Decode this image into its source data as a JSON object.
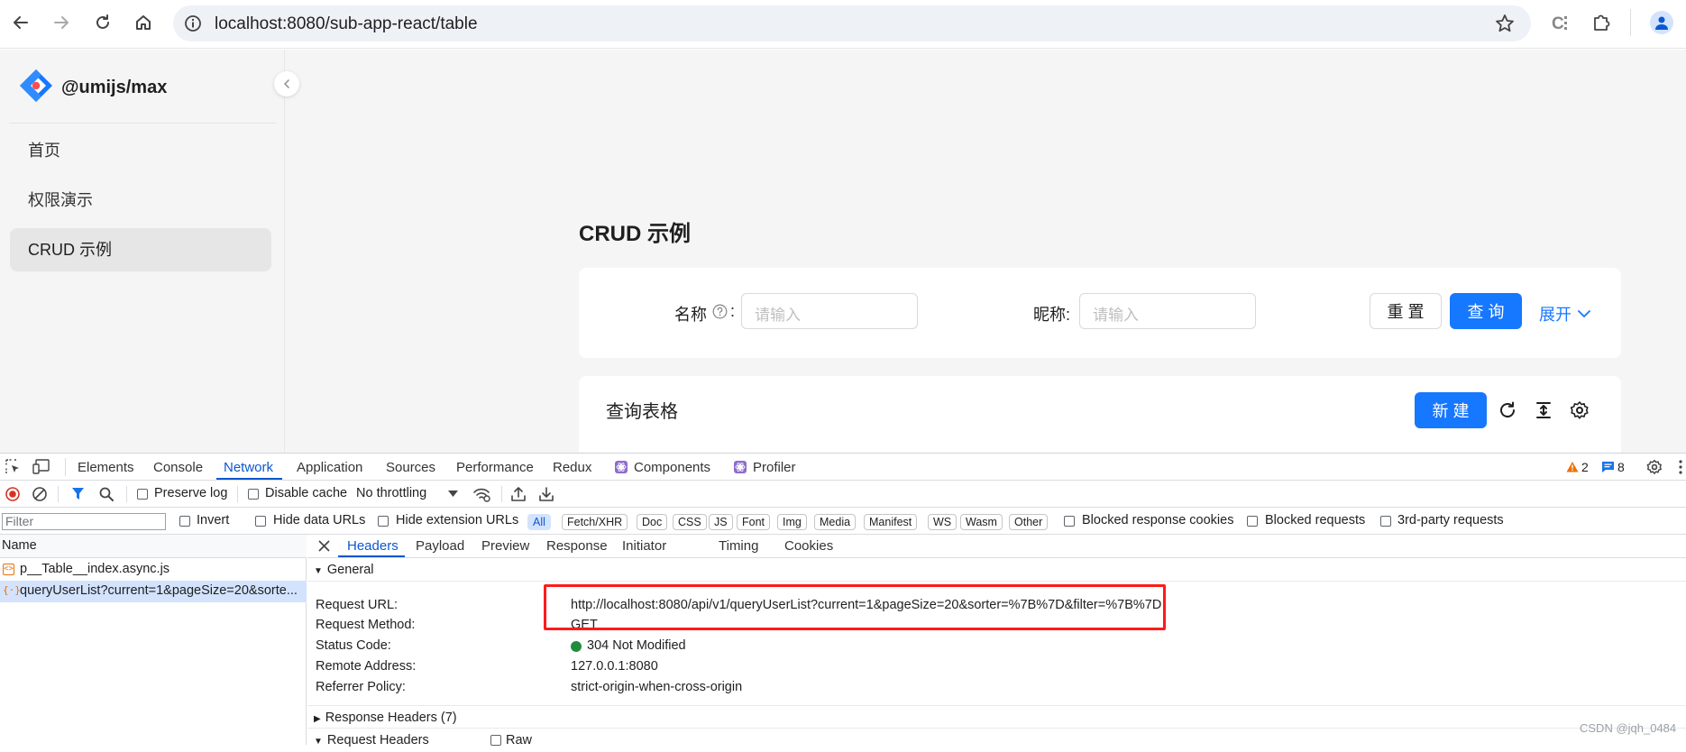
{
  "browser": {
    "url": "localhost:8080/sub-app-react/table",
    "icons": [
      "back-icon",
      "forward-icon",
      "reload-icon",
      "home-icon",
      "site-info-icon",
      "bookmark-star-icon",
      "extension-icon",
      "puzzle-icon",
      "profile-icon"
    ]
  },
  "app": {
    "logo_text": "@umijs/max",
    "menu": [
      {
        "label": "首页"
      },
      {
        "label": "权限演示"
      },
      {
        "label": "CRUD 示例"
      }
    ],
    "page_title": "CRUD 示例",
    "search": {
      "name_label": "名称",
      "name_colon": ":",
      "name_placeholder": "请输入",
      "nickname_label": "昵称:",
      "nickname_placeholder": "请输入",
      "reset_label": "重 置",
      "query_label": "查 询",
      "expand_label": "展开"
    },
    "table": {
      "title": "查询表格",
      "new_label": "新 建"
    }
  },
  "devtools": {
    "tabs": [
      "Elements",
      "Console",
      "Network",
      "Application",
      "Sources",
      "Performance",
      "Redux",
      "Components",
      "Profiler"
    ],
    "active_tab": "Network",
    "warnings": "2",
    "messages": "8",
    "toolbar": {
      "preserve_log": "Preserve log",
      "disable_cache": "Disable cache",
      "throttling": "No throttling"
    },
    "filter": {
      "placeholder": "Filter",
      "invert": "Invert",
      "hide_data_urls": "Hide data URLs",
      "hide_extension_urls": "Hide extension URLs",
      "types": [
        "All",
        "Fetch/XHR",
        "Doc",
        "CSS",
        "JS",
        "Font",
        "Img",
        "Media",
        "Manifest",
        "WS",
        "Wasm",
        "Other"
      ],
      "blocked_cookies": "Blocked response cookies",
      "blocked_requests": "Blocked requests",
      "third_party": "3rd-party requests"
    },
    "requests_header": "Name",
    "requests": [
      {
        "name": "p__Table__index.async.js",
        "icon": "js-file-icon"
      },
      {
        "name": "queryUserList?current=1&pageSize=20&sorte...",
        "icon": "fetch-icon"
      }
    ],
    "detail_tabs": [
      "Headers",
      "Payload",
      "Preview",
      "Response",
      "Initiator",
      "Timing",
      "Cookies"
    ],
    "general_title": "General",
    "general": [
      {
        "key": "Request URL:",
        "value": "http://localhost:8080/api/v1/queryUserList?current=1&pageSize=20&sorter=%7B%7D&filter=%7B%7D"
      },
      {
        "key": "Request Method:",
        "value": "GET"
      },
      {
        "key": "Status Code:",
        "value": "304 Not Modified"
      },
      {
        "key": "Remote Address:",
        "value": "127.0.0.1:8080"
      },
      {
        "key": "Referrer Policy:",
        "value": "strict-origin-when-cross-origin"
      }
    ],
    "response_headers_title": "Response Headers (7)",
    "request_headers_title": "Request Headers",
    "raw_label": "Raw",
    "colors": {
      "accent": "#1677ff",
      "devtools_blue": "#0b57d0",
      "highlight": "#ff1a1a",
      "status_ok": "#1e8e3e"
    }
  },
  "watermark": "CSDN @jqh_0484"
}
